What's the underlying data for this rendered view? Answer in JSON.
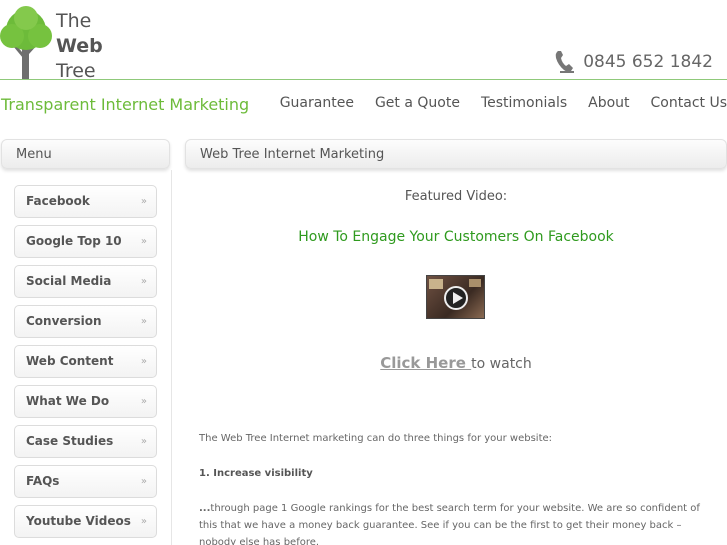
{
  "logo": {
    "line1": "The",
    "line2": "Web",
    "line3": "Tree"
  },
  "header": {
    "phone": "0845 652 1842",
    "tagline": "Transparent Internet Marketing"
  },
  "nav": {
    "items": [
      "Guarantee",
      "Get a Quote",
      "Testimonials",
      "About",
      "Contact Us"
    ]
  },
  "sidebar": {
    "title": "Menu",
    "arrow": "»",
    "items": [
      "Facebook",
      "Google Top 10",
      "Social Media",
      "Conversion",
      "Web Content",
      "What We Do",
      "Case Studies",
      "FAQs",
      "Youtube Videos"
    ]
  },
  "main": {
    "title": "Web Tree Internet Marketing",
    "featured_label": "Featured Video:",
    "video_title": "How To Engage Your Customers On Facebook",
    "click_here": "Click Here ",
    "to_watch": "to watch",
    "intro": "The Web Tree Internet marketing can do three things for your website:",
    "point1": "1. Increase visibility",
    "point1_dots": "...",
    "point1_text": "through page 1 Google rankings for the best search term for your website. We are so confident of this that we have a money back guarantee. See if you can be the first to get their money back – nobody else has before."
  },
  "colors": {
    "accent": "#6dbb3a",
    "link_green": "#2f9a1e",
    "divider": "#8fc97a"
  },
  "icons": {
    "logo": "tree-icon",
    "phone": "phone-icon",
    "video": "play-icon"
  }
}
